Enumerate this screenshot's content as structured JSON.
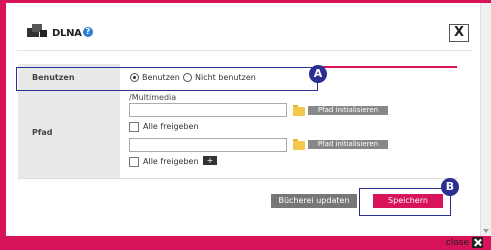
{
  "header": {
    "title": "DLNA",
    "help": "?",
    "close_x": "X"
  },
  "rows": {
    "benutzen": {
      "label": "Benutzen",
      "options": [
        "Benutzen",
        "Nicht benutzen"
      ],
      "selected": "Benutzen"
    },
    "pfad": {
      "label": "Pfad",
      "path_value": "/Multimedia",
      "init_button": "Pfad initialisieren",
      "share_all": "Alle freigeben",
      "add_button": "+"
    }
  },
  "buttons": {
    "update": "Bücherei updaten",
    "save": "Speichern"
  },
  "annotations": {
    "a": "A",
    "b": "B"
  },
  "footer": {
    "close": "close"
  },
  "colors": {
    "accent": "#d8135a",
    "highlight": "#2b2f8f"
  }
}
